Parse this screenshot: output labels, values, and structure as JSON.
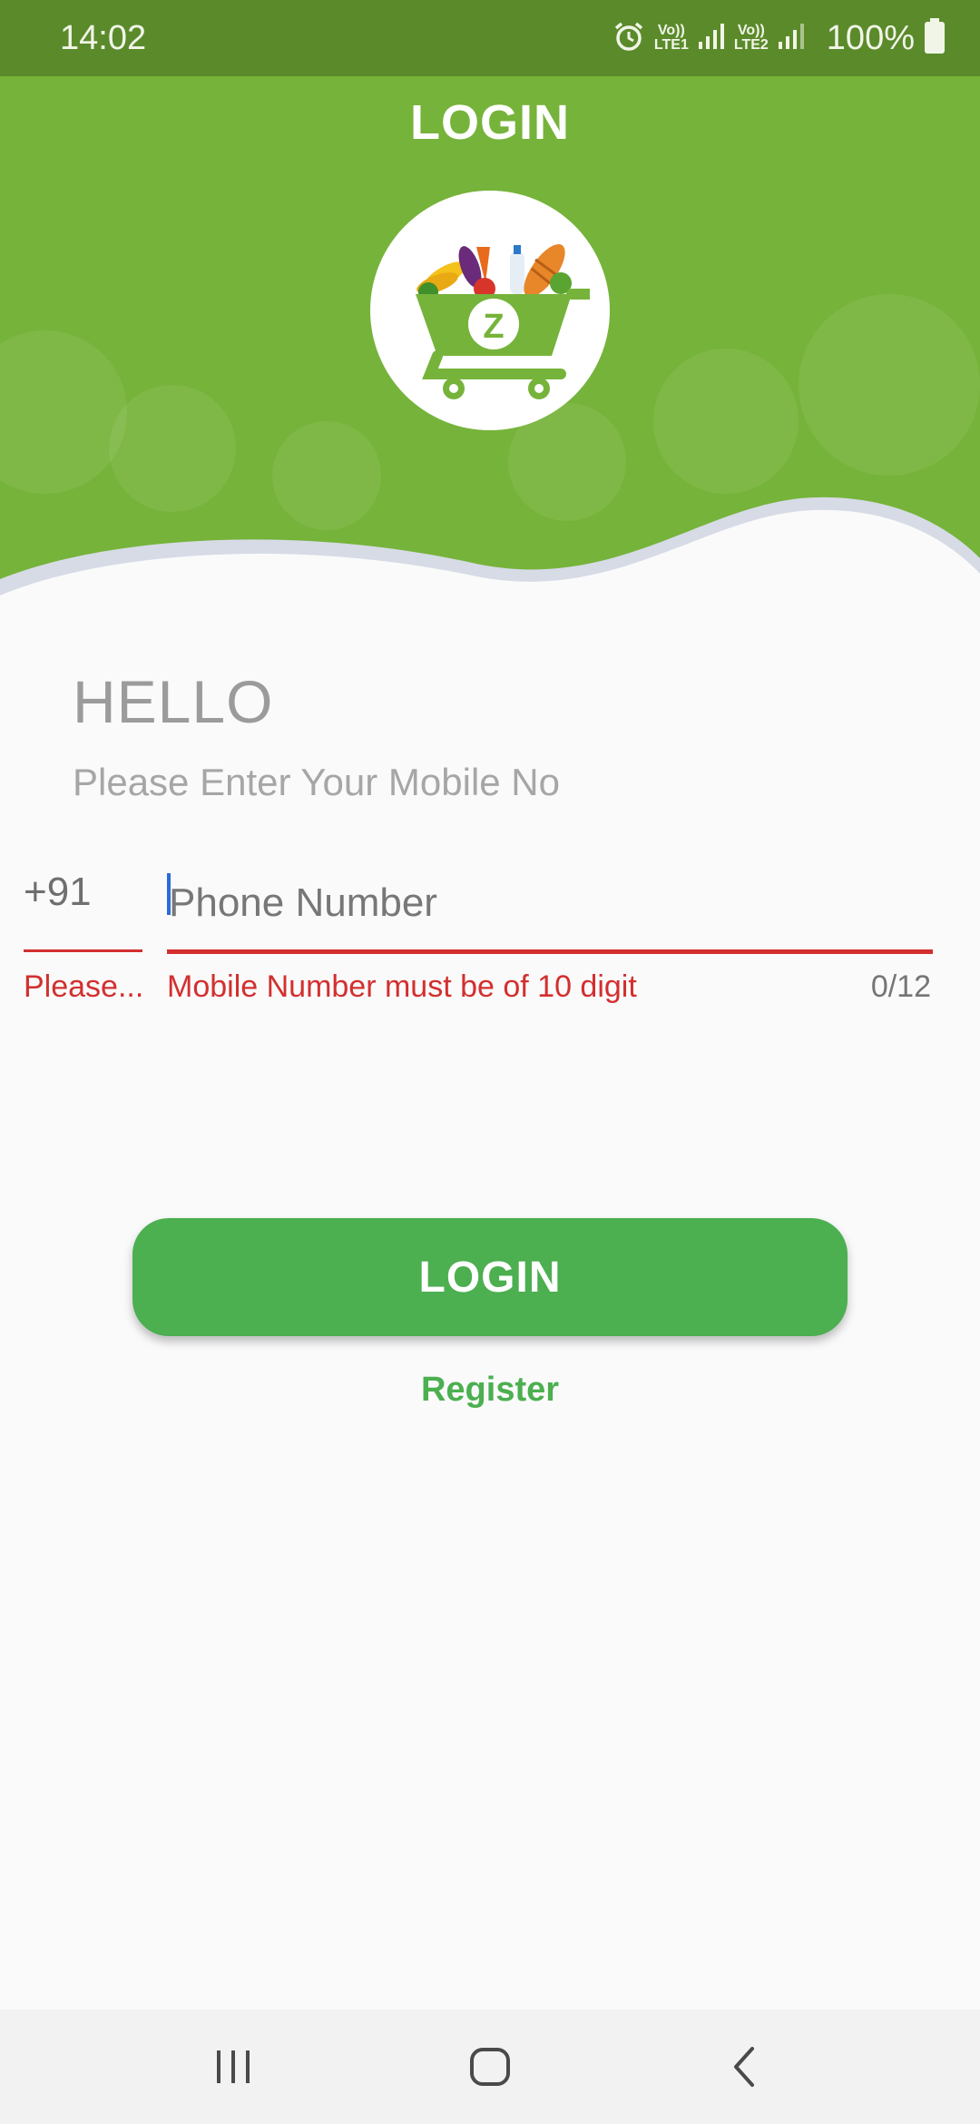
{
  "status_bar": {
    "time": "14:02",
    "battery": "100%",
    "sim1_label": "Vo))\nLTE1",
    "sim2_label": "Vo))\nLTE2"
  },
  "header": {
    "title": "LOGIN",
    "logo_letter": "Z"
  },
  "greeting": {
    "title": "HELLO",
    "subtitle": "Please Enter Your Mobile No"
  },
  "form": {
    "country_code": "+91",
    "country_code_error": "Please...",
    "phone_placeholder": "Phone Number",
    "phone_value": "",
    "phone_error": "Mobile Number must be of 10 digit",
    "char_counter": "0/12"
  },
  "actions": {
    "login_label": "LOGIN",
    "register_label": "Register"
  },
  "nav": {
    "recents_icon": "recents-icon",
    "home_icon": "home-icon",
    "back_icon": "back-icon"
  },
  "colors": {
    "status_bar": "#5b8a2b",
    "header_green": "#76b33a",
    "button_green": "#4caf50",
    "error_red": "#d32f2f"
  }
}
